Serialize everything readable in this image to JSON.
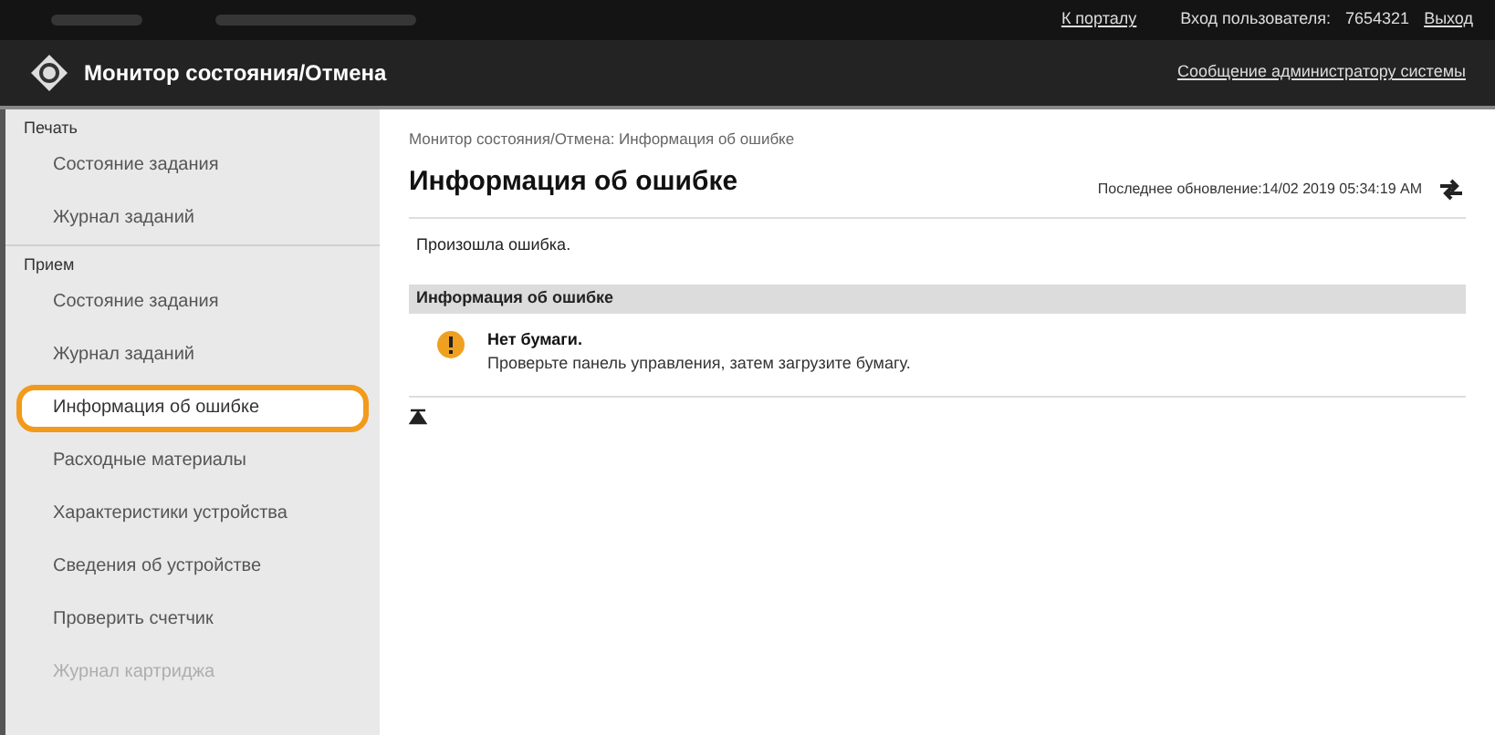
{
  "top_bar": {
    "links": [
      {
        "label": "К порталу"
      }
    ],
    "user_label": "Вход пользователя:",
    "user_id": "7654321",
    "logout": "Выход"
  },
  "header": {
    "title": "Монитор состояния/Отмена",
    "admin_message": "Сообщение администратору системы"
  },
  "sidebar": {
    "sections": [
      {
        "title": "Печать",
        "items": [
          {
            "label": "Состояние задания",
            "selected": false,
            "faded": false
          },
          {
            "label": "Журнал заданий",
            "selected": false,
            "faded": false
          }
        ]
      },
      {
        "title": "Прием",
        "items": [
          {
            "label": "Состояние задания",
            "selected": false,
            "faded": false
          },
          {
            "label": "Журнал заданий",
            "selected": false,
            "faded": false
          },
          {
            "label": "Информация об ошибке",
            "selected": true,
            "faded": false
          },
          {
            "label": "Расходные материалы",
            "selected": false,
            "faded": false
          },
          {
            "label": "Характеристики устройства",
            "selected": false,
            "faded": false
          },
          {
            "label": "Сведения об устройстве",
            "selected": false,
            "faded": false
          },
          {
            "label": "Проверить счетчик",
            "selected": false,
            "faded": false
          },
          {
            "label": "Журнал картриджа",
            "selected": false,
            "faded": true
          }
        ]
      }
    ]
  },
  "main": {
    "breadcrumb": "Монитор состояния/Отмена: Информация об ошибке",
    "title": "Информация об ошибке",
    "last_update": "Последнее обновление:14/02 2019 05:34:19 AM",
    "message": "Произошла ошибка.",
    "section_title": "Информация об ошибке",
    "errors": [
      {
        "title": "Нет бумаги.",
        "detail": "Проверьте панель управления, затем загрузите бумагу."
      }
    ]
  }
}
